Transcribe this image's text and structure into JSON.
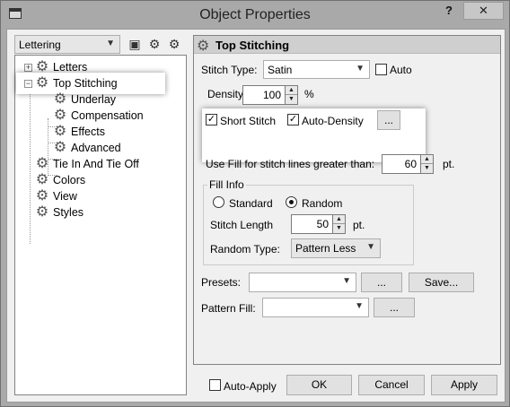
{
  "window": {
    "title": "Object Properties",
    "help": "?",
    "close": "✕"
  },
  "left": {
    "combo_value": "Lettering",
    "tree": [
      {
        "label": "Letters"
      },
      {
        "label": "Top Stitching"
      },
      {
        "label": "Underlay"
      },
      {
        "label": "Compensation"
      },
      {
        "label": "Effects"
      },
      {
        "label": "Advanced"
      },
      {
        "label": "Tie In And Tie Off"
      },
      {
        "label": "Colors"
      },
      {
        "label": "View"
      },
      {
        "label": "Styles"
      }
    ]
  },
  "panel": {
    "header": "Top Stitching",
    "stitch_type_label": "Stitch Type:",
    "stitch_type_value": "Satin",
    "auto_label": "Auto",
    "density_label": "Density",
    "density_value": "100",
    "density_unit": "%",
    "short_stitch_label": "Short Stitch",
    "auto_density_label": "Auto-Density",
    "ellipsis": "...",
    "use_fill_label": "Use Fill for stitch lines greater than:",
    "use_fill_value": "60",
    "use_fill_unit": "pt.",
    "fill_info_title": "Fill Info",
    "standard_label": "Standard",
    "random_label": "Random",
    "stitch_length_label": "Stitch Length",
    "stitch_length_value": "50",
    "stitch_length_unit": "pt.",
    "random_type_label": "Random Type:",
    "random_type_value": "Pattern Less",
    "presets_label": "Presets:",
    "presets_value": "",
    "save_label": "Save...",
    "pattern_fill_label": "Pattern Fill:",
    "pattern_fill_value": ""
  },
  "footer": {
    "auto_apply_label": "Auto-Apply",
    "ok_label": "OK",
    "cancel_label": "Cancel",
    "apply_label": "Apply"
  },
  "checkbox_states": {
    "auto": false,
    "short_stitch": true,
    "auto_density": true,
    "auto_apply": false
  },
  "radio_state": "random"
}
